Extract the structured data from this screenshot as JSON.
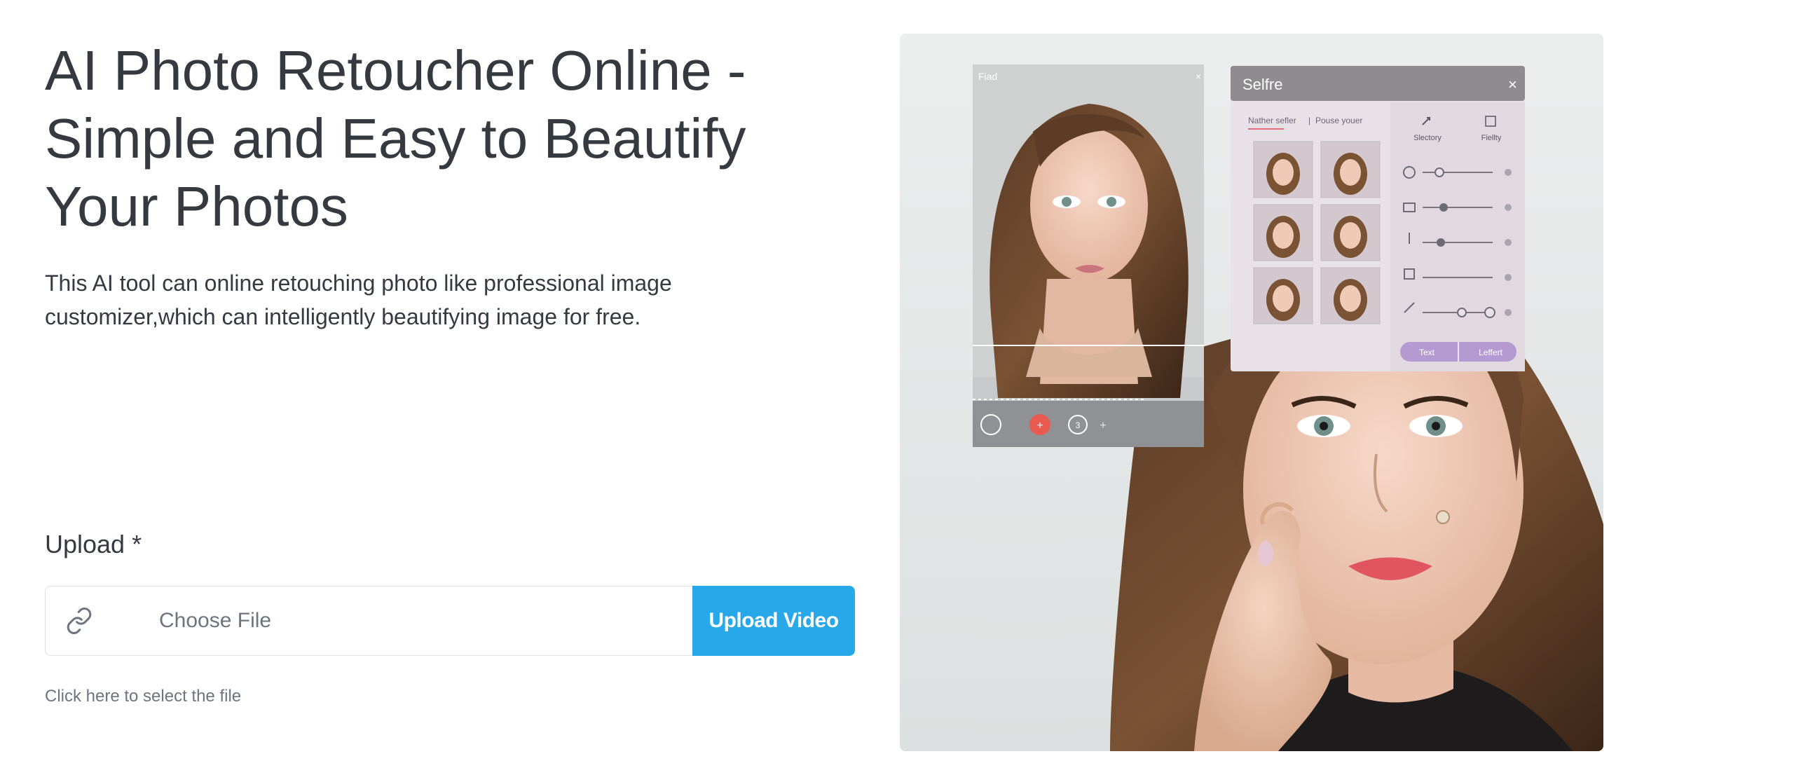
{
  "hero": {
    "title": "AI Photo Retoucher Online - Simple and Easy to Beautify Your Photos",
    "description": "This AI tool can online retouching photo like professional image customizer,which can intelligently beautifying image for free."
  },
  "upload": {
    "label": "Upload *",
    "file_placeholder": "Choose File",
    "button_label": "Upload Video",
    "hint": "Click here to select the file"
  },
  "image_mockup": {
    "left_panel_title": "Fiad",
    "panel_title": "Selfre",
    "tab_1": "Nather sefler",
    "tab_2": "Pouse youer",
    "tool_1": "Slectory",
    "tool_2": "Fiellty",
    "btn_left": "Text",
    "btn_right": "Leffert",
    "badge_number": "3"
  },
  "colors": {
    "button": "#27a8ea",
    "panel_header": "#8e8c8f",
    "panel_accent": "#b49ad0",
    "record_button": "#e8594f"
  }
}
